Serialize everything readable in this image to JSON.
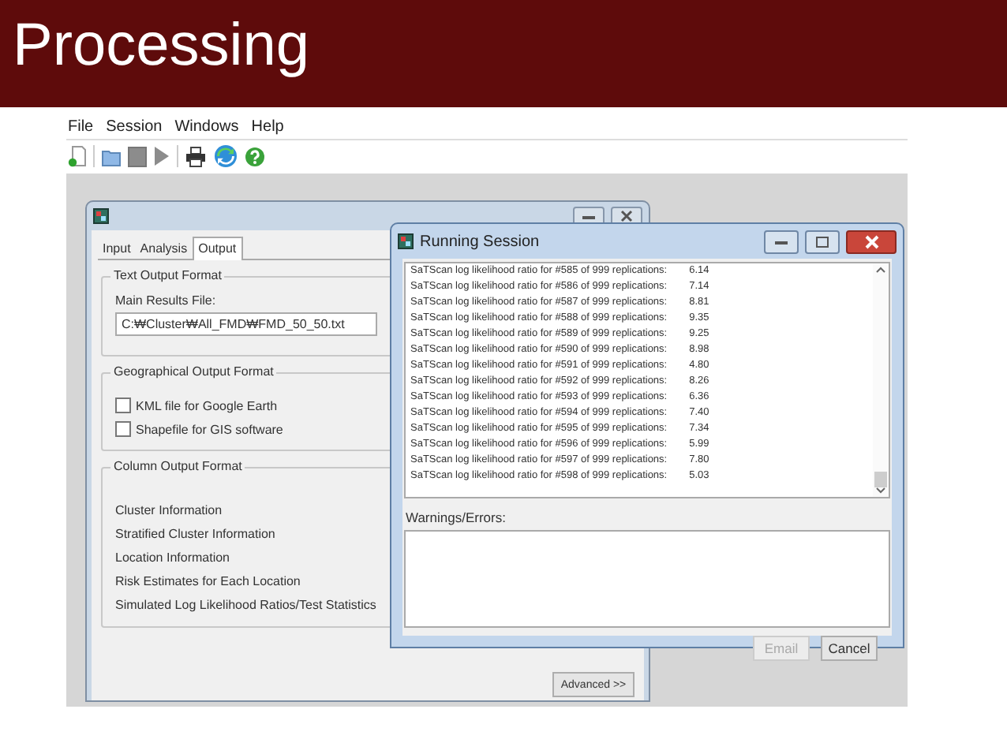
{
  "slide": {
    "title": "Processing"
  },
  "menu": [
    "File",
    "Session",
    "Windows",
    "Help"
  ],
  "parameters_window": {
    "tabs": [
      {
        "label": "Input",
        "selected": false
      },
      {
        "label": "Analysis",
        "selected": false
      },
      {
        "label": "Output",
        "selected": true
      }
    ],
    "text_output": {
      "legend": "Text Output Format",
      "label": "Main Results File:",
      "value": "C:₩Cluster₩All_FMD₩FMD_50_50.txt"
    },
    "geo_output": {
      "legend": "Geographical Output Format",
      "options": [
        {
          "label": "KML file for Google Earth",
          "checked": false
        },
        {
          "label": "Shapefile for GIS software",
          "checked": false
        }
      ]
    },
    "column_output": {
      "legend": "Column Output Format",
      "items": [
        "Cluster Information",
        "Stratified Cluster Information",
        "Location Information",
        "Risk Estimates for Each Location",
        "Simulated Log Likelihood Ratios/Test Statistics"
      ]
    },
    "advanced_button": "Advanced >>"
  },
  "session_window": {
    "title": "Running Session",
    "log": [
      {
        "text": "SaTScan log likelihood ratio for #585 of 999 replications:",
        "value": "6.14"
      },
      {
        "text": "SaTScan log likelihood ratio for #586 of 999 replications:",
        "value": "7.14"
      },
      {
        "text": "SaTScan log likelihood ratio for #587 of 999 replications:",
        "value": "8.81"
      },
      {
        "text": "SaTScan log likelihood ratio for #588 of 999 replications:",
        "value": "9.35"
      },
      {
        "text": "SaTScan log likelihood ratio for #589 of 999 replications:",
        "value": "9.25"
      },
      {
        "text": "SaTScan log likelihood ratio for #590 of 999 replications:",
        "value": "8.98"
      },
      {
        "text": "SaTScan log likelihood ratio for #591 of 999 replications:",
        "value": "4.80"
      },
      {
        "text": "SaTScan log likelihood ratio for #592 of 999 replications:",
        "value": "8.26"
      },
      {
        "text": "SaTScan log likelihood ratio for #593 of 999 replications:",
        "value": "6.36"
      },
      {
        "text": "SaTScan log likelihood ratio for #594 of 999 replications:",
        "value": "7.40"
      },
      {
        "text": "SaTScan log likelihood ratio for #595 of 999 replications:",
        "value": "7.34"
      },
      {
        "text": "SaTScan log likelihood ratio for #596 of 999 replications:",
        "value": "5.99"
      },
      {
        "text": "SaTScan log likelihood ratio for #597 of 999 replications:",
        "value": "7.80"
      },
      {
        "text": "SaTScan log likelihood ratio for #598 of 999 replications:",
        "value": "5.03"
      }
    ],
    "warnings_label": "Warnings/Errors:",
    "buttons": [
      {
        "label": "Email",
        "disabled": true
      },
      {
        "label": "Cancel",
        "disabled": false
      }
    ]
  }
}
